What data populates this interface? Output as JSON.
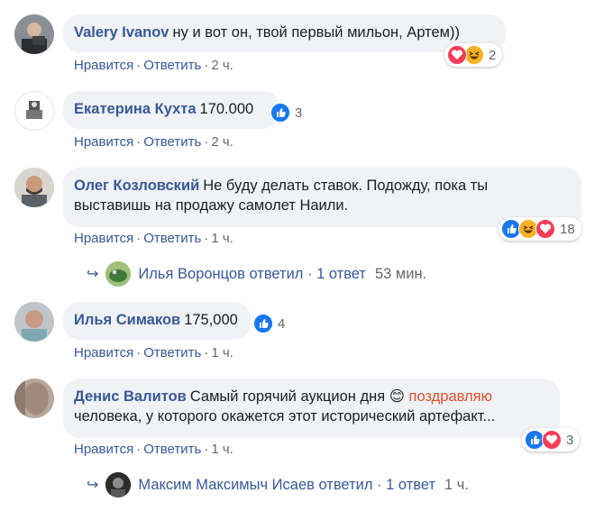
{
  "comments": [
    {
      "author": "Valery Ivanov",
      "text": "ну и вот он, твой первый мильон, Артем))",
      "like_label": "Нравится",
      "reply_label": "Ответить",
      "time": "2 ч.",
      "reactions_count": "2",
      "reaction_icons": [
        "heart-icon",
        "haha-icon"
      ]
    },
    {
      "author": "Екатерина Кухта",
      "text": "170.000",
      "like_label": "Нравится",
      "reply_label": "Ответить",
      "time": "2 ч.",
      "reactions_count": "3",
      "reaction_icons": [
        "like-icon"
      ]
    },
    {
      "author": "Олег Козловский",
      "text_line1": "Не буду делать ставок. Подожду, пока ты",
      "text_line2": "выставишь на продажу самолет Наили.",
      "like_label": "Нравится",
      "reply_label": "Ответить",
      "time": "1 ч.",
      "reactions_count": "18",
      "reaction_icons": [
        "like-icon",
        "haha-icon",
        "heart-icon"
      ],
      "reply_summary": {
        "text": "Илья Воронцов ответил · 1 ответ",
        "time": "53 мин."
      }
    },
    {
      "author": "Илья Симаков",
      "text": "175,000",
      "like_label": "Нравится",
      "reply_label": "Ответить",
      "time": "1 ч.",
      "reactions_count": "4",
      "reaction_icons": [
        "like-icon"
      ]
    },
    {
      "author": "Денис Валитов",
      "text_line1_a": "Самый горячий аукцион дня",
      "emoji": "😊",
      "mention": "поздравляю",
      "text_line2": "человека, у которого окажется этот исторический артефакт...",
      "like_label": "Нравится",
      "reply_label": "Ответить",
      "time": "1 ч.",
      "reactions_count": "3",
      "reaction_icons": [
        "like-icon",
        "heart-icon"
      ],
      "reply_summary": {
        "text": "Максим Максимыч Исаев ответил · 1 ответ",
        "time": "1 ч."
      }
    }
  ],
  "colors": {
    "link": "#385898",
    "meta": "#65676b",
    "bubble": "#f0f2f5",
    "mention": "#e04f2c",
    "like": "#1877f2",
    "heart": "#f33e58",
    "haha": "#f7b125"
  }
}
